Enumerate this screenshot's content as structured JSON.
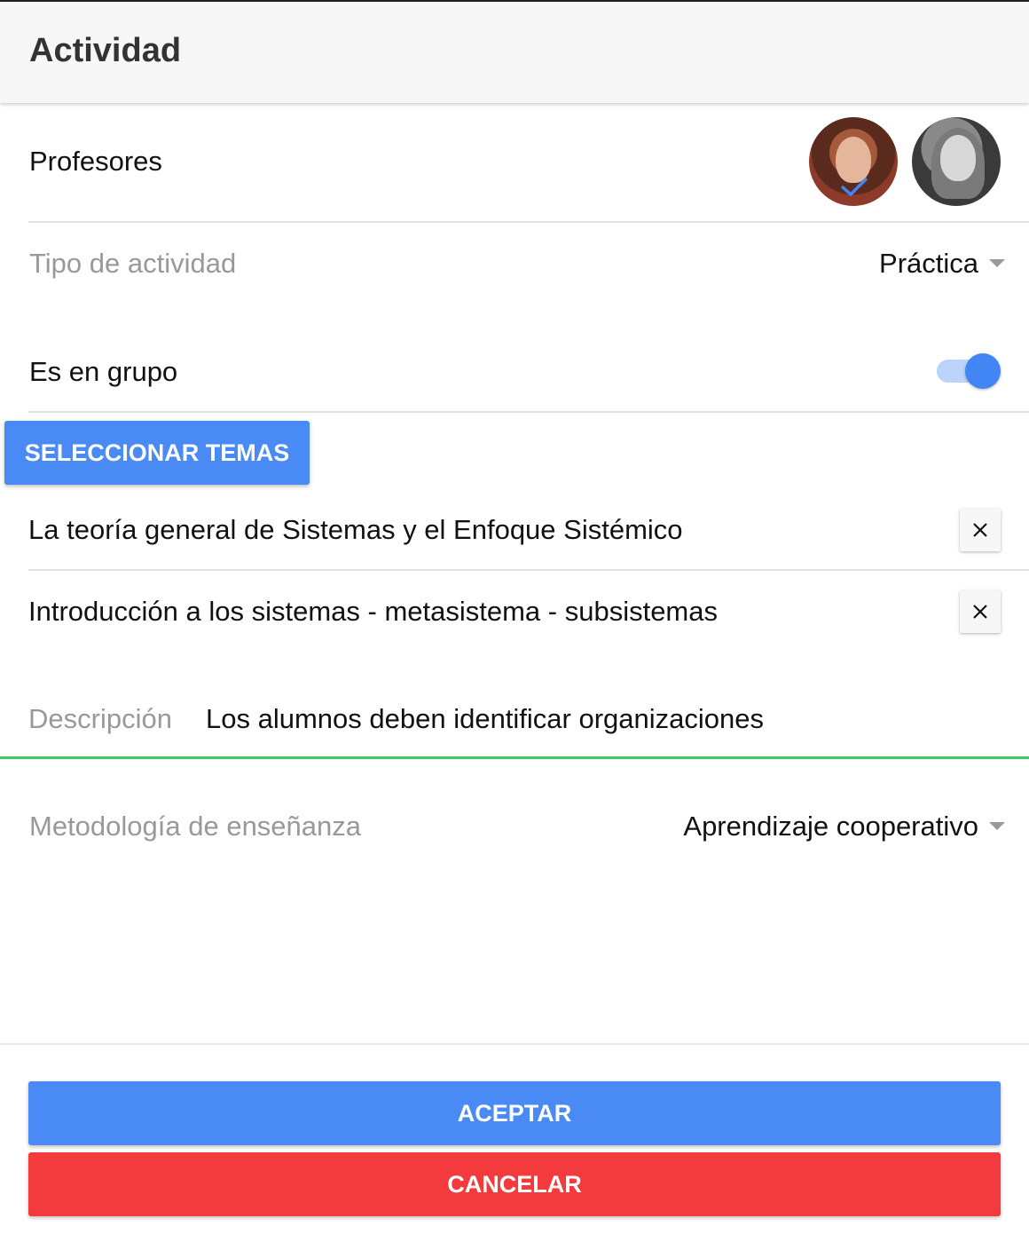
{
  "header": {
    "title": "Actividad"
  },
  "teachers": {
    "label": "Profesores",
    "avatars": [
      "avatar-teacher-selected",
      "avatar-teacher"
    ]
  },
  "activity_type": {
    "label": "Tipo de actividad",
    "value": "Práctica"
  },
  "group": {
    "label": "Es en grupo",
    "enabled": true
  },
  "topics": {
    "select_button": "SELECCIONAR TEMAS",
    "items": [
      {
        "text": "La teoría general de Sistemas y el Enfoque Sistémico",
        "remove_icon": "close-icon"
      },
      {
        "text": "Introducción a los sistemas - metasistema - subsistemas",
        "remove_icon": "close-icon"
      }
    ]
  },
  "description": {
    "label": "Descripción",
    "value": "Los alumnos deben identificar organizaciones"
  },
  "methodology": {
    "label": "Metodología de enseñanza",
    "value": "Aprendizaje cooperativo"
  },
  "actions": {
    "accept": "ACEPTAR",
    "cancel": "CANCELAR"
  },
  "colors": {
    "primary": "#4a8af4",
    "danger": "#f33b3e",
    "focus_underline": "#3cc864",
    "muted_text": "#999999"
  }
}
